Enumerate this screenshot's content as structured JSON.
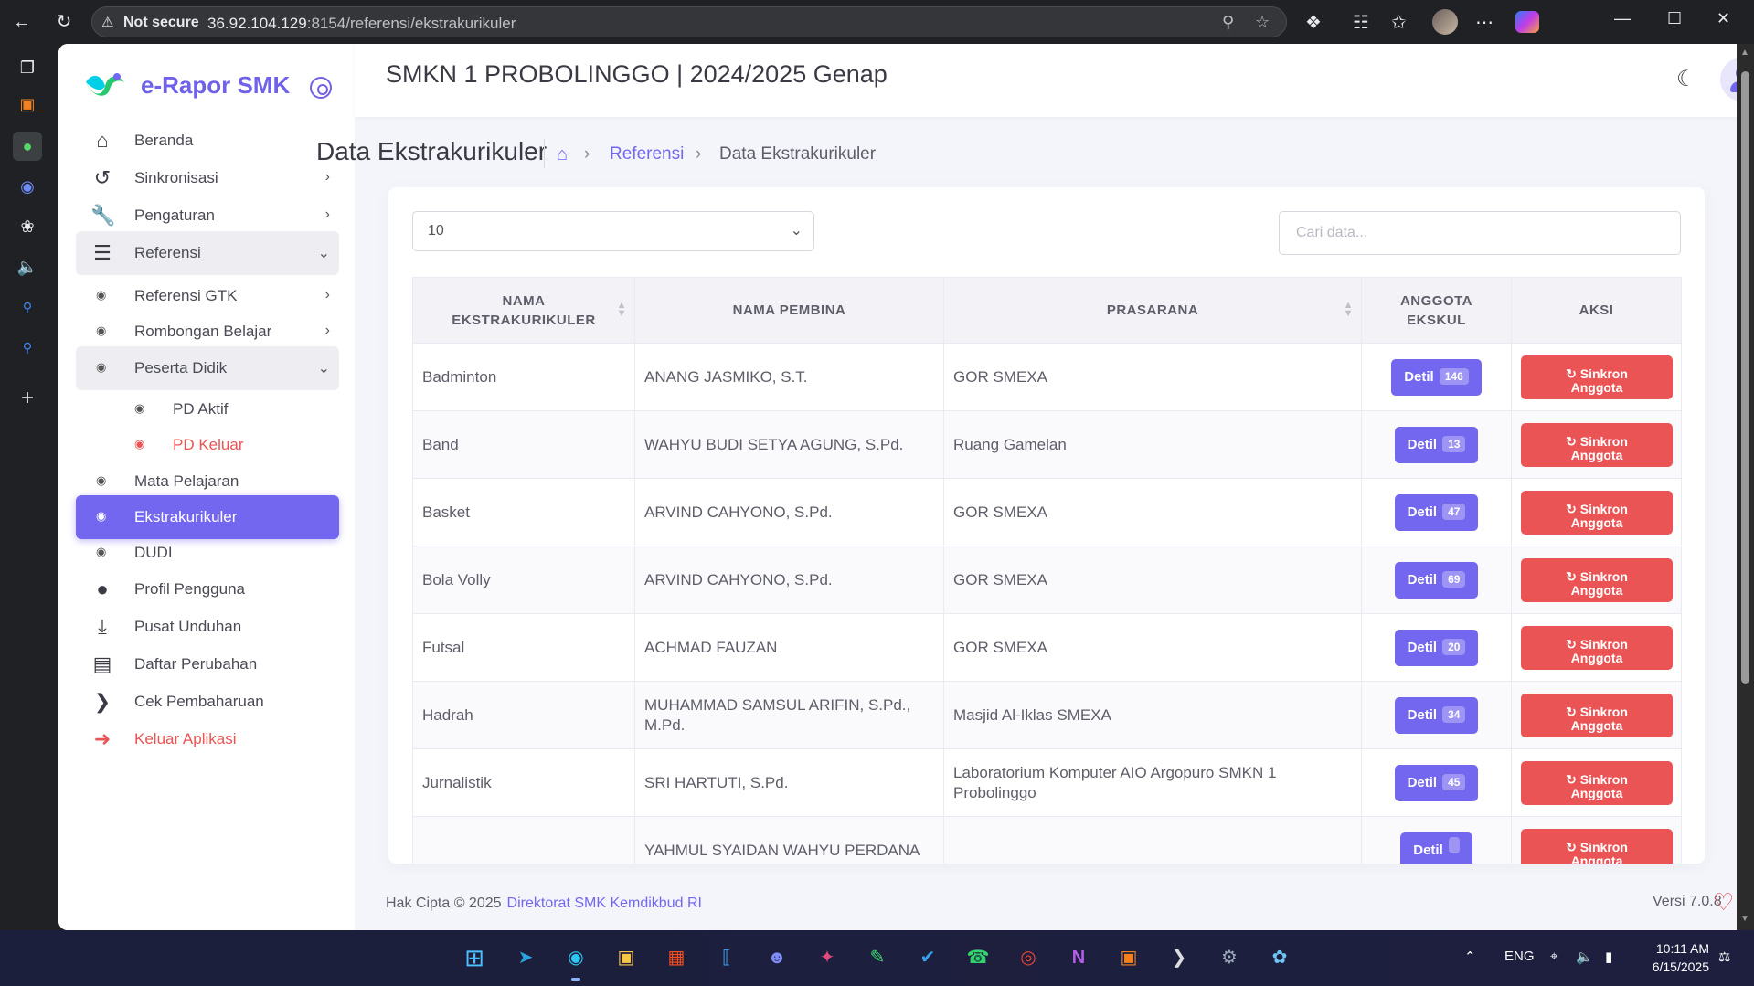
{
  "browser": {
    "not_secure": "Not secure",
    "url_host": "36.92.104.129",
    "url_rest": ":8154/referensi/ekstrakurikuler"
  },
  "app": {
    "brand": "e-Rapor SMK",
    "header_title": "SMKN 1 PROBOLINGGO | 2024/2025 Genap",
    "accent": "#7367f0",
    "danger": "#ea5455"
  },
  "sidebar": {
    "beranda": "Beranda",
    "sinkronisasi": "Sinkronisasi",
    "pengaturan": "Pengaturan",
    "referensi": "Referensi",
    "referensi_gtk": "Referensi GTK",
    "rombongan_belajar": "Rombongan Belajar",
    "peserta_didik": "Peserta Didik",
    "pd_aktif": "PD Aktif",
    "pd_keluar": "PD Keluar",
    "mata_pelajaran": "Mata Pelajaran",
    "ekstrakurikuler": "Ekstrakurikuler",
    "dudi": "DUDI",
    "profil_pengguna": "Profil Pengguna",
    "pusat_unduhan": "Pusat Unduhan",
    "daftar_perubahan": "Daftar Perubahan",
    "cek_pembaharuan": "Cek Pembaharuan",
    "keluar_aplikasi": "Keluar Aplikasi"
  },
  "page": {
    "title": "Data Ekstrakurikuler",
    "breadcrumb_referensi": "Referensi",
    "breadcrumb_current": "Data Ekstrakurikuler",
    "per_page": "10",
    "search_placeholder": "Cari data..."
  },
  "table": {
    "headers": {
      "nama_1": "NAMA",
      "nama_2": "EKSTRAKURIKULER",
      "pembina": "NAMA PEMBINA",
      "prasarana": "PRASARANA",
      "anggota_1": "ANGGOTA",
      "anggota_2": "EKSKUL",
      "aksi": "AKSI"
    },
    "detil_label": "Detil",
    "sinkron_label_1": "Sinkron",
    "sinkron_label_2": "Anggota",
    "rows": [
      {
        "nama": "Badminton",
        "pembina": "ANANG JASMIKO, S.T.",
        "prasarana": "GOR SMEXA",
        "anggota": "146"
      },
      {
        "nama": "Band",
        "pembina": "WAHYU BUDI SETYA AGUNG, S.Pd.",
        "prasarana": "Ruang Gamelan",
        "anggota": "13"
      },
      {
        "nama": "Basket",
        "pembina": "ARVIND CAHYONO, S.Pd.",
        "prasarana": "GOR SMEXA",
        "anggota": "47"
      },
      {
        "nama": "Bola Volly",
        "pembina": "ARVIND CAHYONO, S.Pd.",
        "prasarana": "GOR SMEXA",
        "anggota": "69"
      },
      {
        "nama": "Futsal",
        "pembina": "ACHMAD FAUZAN",
        "prasarana": "GOR SMEXA",
        "anggota": "20"
      },
      {
        "nama": "Hadrah",
        "pembina": "MUHAMMAD SAMSUL ARIFIN, S.Pd., M.Pd.",
        "prasarana": "Masjid Al-Iklas SMEXA",
        "anggota": "34"
      },
      {
        "nama": "Jurnalistik",
        "pembina": "SRI HARTUTI, S.Pd.",
        "prasarana": "Laboratorium Komputer AIO Argopuro SMKN 1 Probolinggo",
        "anggota": "45"
      },
      {
        "nama": "",
        "pembina": "YAHMUL SYAIDAN WAHYU PERDANA",
        "prasarana": "",
        "anggota": ""
      }
    ]
  },
  "footer": {
    "copyright": "Hak Cipta © 2025",
    "link": "Direktorat SMK Kemdikbud RI",
    "version": "Versi 7.0.8"
  },
  "taskbar": {
    "lang": "ENG",
    "time": "10:11 AM",
    "date": "6/15/2025"
  }
}
